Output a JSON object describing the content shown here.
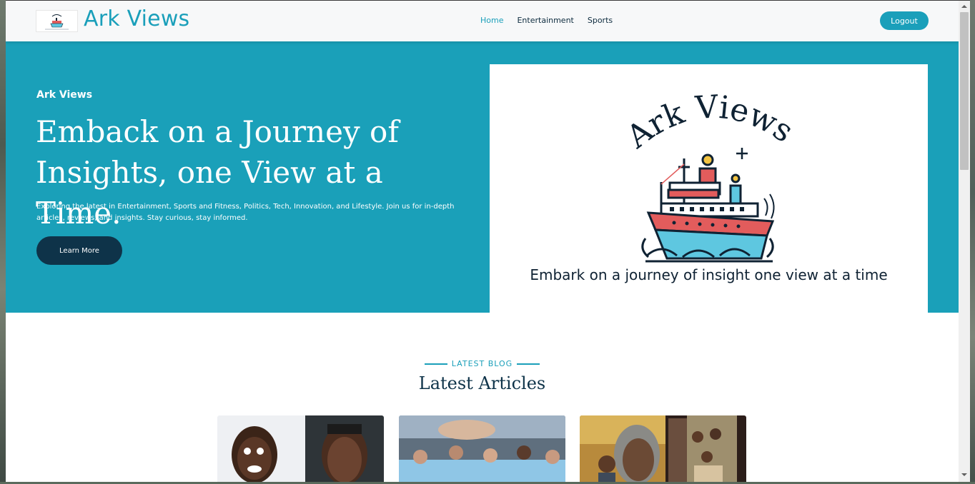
{
  "nav": {
    "brand": "Ark Views",
    "links": [
      {
        "label": "Home",
        "active": true
      },
      {
        "label": "Entertainment",
        "active": false
      },
      {
        "label": "Sports",
        "active": false
      }
    ],
    "logout_label": "Logout"
  },
  "hero": {
    "brand": "Ark Views",
    "title": "Emback on a Journey of Insights, one View at a Time.",
    "subtitle": "Exploring the latest in Entertainment, Sports and Fitness, Politics, Tech, Innovation, and Lifestyle. Join us for in-depth articles, reviews, and insights. Stay curious, stay informed.",
    "button_label": "Learn More",
    "image": {
      "logo_text": "Ark Views",
      "tagline": "Embark on a journey of insight one view at a time"
    }
  },
  "articles": {
    "eyebrow": "LATEST BLOG",
    "title": "Latest Articles"
  },
  "colors": {
    "accent": "#1a9fba",
    "dark": "#0e3349"
  }
}
